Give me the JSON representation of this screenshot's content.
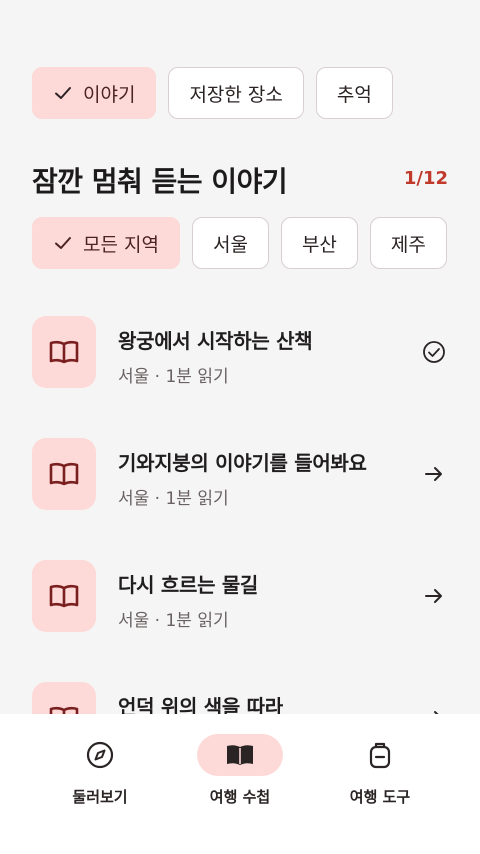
{
  "filters": {
    "items": [
      {
        "label": "이야기",
        "active": true
      },
      {
        "label": "저장한 장소",
        "active": false
      },
      {
        "label": "추억",
        "active": false
      }
    ]
  },
  "section": {
    "title": "잠깐 멈춰 듣는 이야기",
    "count": "1/12"
  },
  "regions": {
    "items": [
      {
        "label": "모든 지역",
        "active": true
      },
      {
        "label": "서울",
        "active": false
      },
      {
        "label": "부산",
        "active": false
      },
      {
        "label": "제주",
        "active": false
      }
    ]
  },
  "stories": [
    {
      "title": "왕궁에서 시작하는 산책",
      "meta": "서울 · 1분 읽기",
      "status_icon": "check-circle-icon"
    },
    {
      "title": "기와지붕의 이야기를 들어봐요",
      "meta": "서울 · 1분 읽기",
      "status_icon": "arrow-right-icon"
    },
    {
      "title": "다시 흐르는 물길",
      "meta": "서울 · 1분 읽기",
      "status_icon": "arrow-right-icon"
    },
    {
      "title": "언덕 위의 색을 따라",
      "meta": "",
      "status_icon": "arrow-right-icon"
    }
  ],
  "nav": {
    "items": [
      {
        "label": "둘러보기",
        "icon": "compass-icon",
        "active": false
      },
      {
        "label": "여행 수첩",
        "icon": "book-open-icon",
        "active": true
      },
      {
        "label": "여행 도구",
        "icon": "backpack-icon",
        "active": false
      }
    ]
  },
  "colors": {
    "accent_bg": "#fdd9d7",
    "accent_text": "#c0392b",
    "icon_dark": "#7a1f1f"
  }
}
